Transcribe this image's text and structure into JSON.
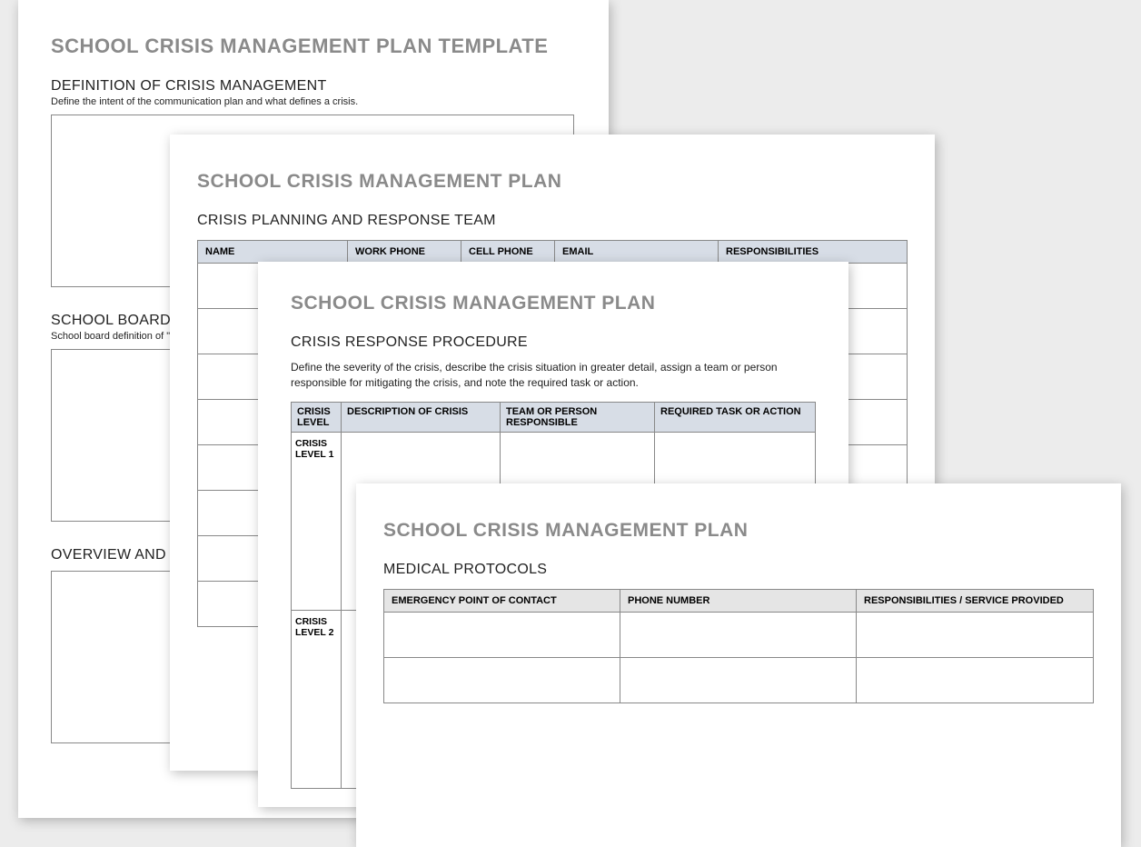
{
  "page1": {
    "title": "SCHOOL CRISIS MANAGEMENT PLAN TEMPLATE",
    "section1": {
      "heading": "DEFINITION OF CRISIS MANAGEMENT",
      "sub": "Define the intent of the communication plan and what defines a crisis."
    },
    "section2": {
      "heading": "SCHOOL BOARD P",
      "sub": "School board definition of \"c"
    },
    "section3": {
      "heading": "OVERVIEW AND RA"
    }
  },
  "page2": {
    "title": "SCHOOL CRISIS MANAGEMENT PLAN",
    "section": "CRISIS PLANNING AND RESPONSE TEAM",
    "headers": [
      "NAME",
      "WORK PHONE",
      "CELL PHONE",
      "EMAIL",
      "RESPONSIBILITIES"
    ]
  },
  "page3": {
    "title": "SCHOOL CRISIS MANAGEMENT PLAN",
    "section": "CRISIS RESPONSE PROCEDURE",
    "sub": "Define the severity of the crisis, describe the crisis situation in greater detail, assign a team or person responsible for mitigating the crisis, and note the required task or action.",
    "headers": [
      "CRISIS LEVEL",
      "DESCRIPTION OF CRISIS",
      "TEAM OR PERSON RESPONSIBLE",
      "REQUIRED TASK OR ACTION"
    ],
    "rowLabels": [
      "CRISIS LEVEL 1",
      "CRISIS LEVEL 2"
    ]
  },
  "page4": {
    "title": "SCHOOL CRISIS MANAGEMENT PLAN",
    "section": "MEDICAL PROTOCOLS",
    "headers": [
      "EMERGENCY POINT OF CONTACT",
      "PHONE NUMBER",
      "RESPONSIBILITIES / SERVICE PROVIDED"
    ]
  }
}
